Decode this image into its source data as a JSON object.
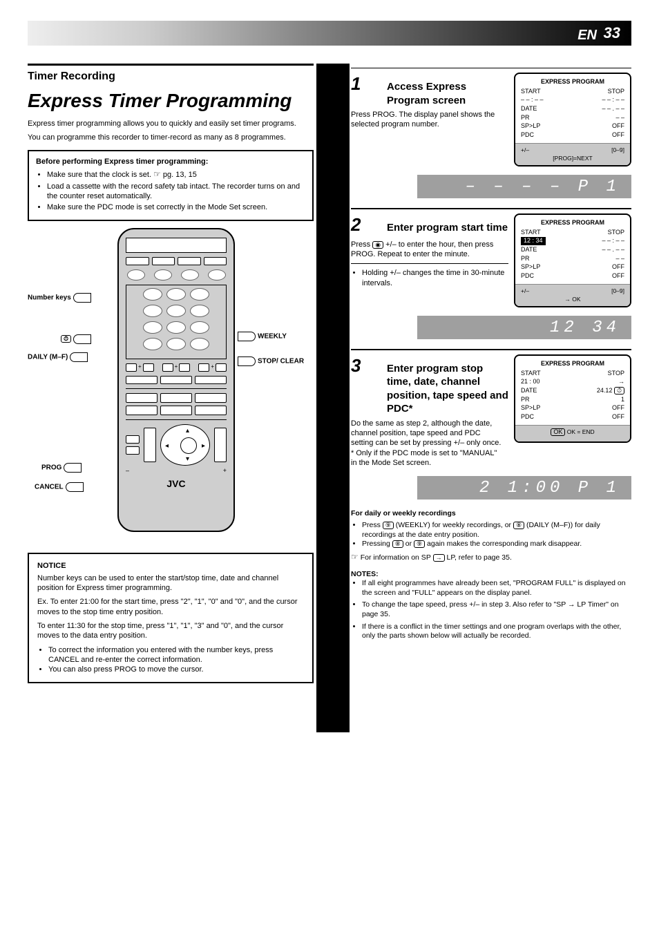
{
  "page": {
    "number": "33",
    "section": "EN"
  },
  "left": {
    "big_title": "Express Timer Programming",
    "sub_title": "Timer Recording",
    "intro1": "Express timer programming allows you to quickly and easily set timer programs.",
    "intro2": "You can programme this recorder to timer-record as many as 8 programmes.",
    "before": {
      "heading": "Before performing Express timer programming:",
      "i1_a": "Make sure that the clock is set.",
      "i1_b": "pg. 13, 15",
      "i2": "Load a cassette with the record safety tab intact. The recorder turns on and the counter reset automatically.",
      "i3": "Make sure the PDC mode is set correctly in the Mode Set screen."
    },
    "callouts": {
      "number": "Number keys",
      "timer_key": "⏱",
      "daily": "DAILY (M–F)",
      "weekly": "WEEKLY",
      "prog": "PROG",
      "cancel": "CANCEL",
      "stop": "STOP/ CLEAR"
    },
    "remote_logo": "JVC",
    "notice": {
      "title": "NOTICE",
      "p1": "Number keys can be used to enter the start/stop time, date and channel position for Express timer programming.",
      "p2_a": "Ex. To enter 21:00 for the start time, press \"2\", \"1\", \"0\" and \"0\", and the cursor moves to the stop time entry position.",
      "p2_b": "To enter 11:30 for the stop time, press \"1\", \"1\", \"3\" and \"0\", and the cursor moves to the data entry position.",
      "li1": "To correct the information you entered with the number keys, press CANCEL and re-enter the correct information.",
      "li2": "You can also press PROG to move the cursor."
    }
  },
  "right": {
    "s1": {
      "num": "1",
      "title": "Access Express Program screen",
      "body": "Press PROG. The display panel shows the selected program number.",
      "osd": {
        "title": "EXPRESS PROGRAM",
        "r1l": "START",
        "r1r": "STOP",
        "r2l": "– – : – –",
        "r2r": "– – : – –",
        "r3l": "DATE",
        "r3r": "– – . – –",
        "r4l": "PR",
        "r4r": "– –",
        "r5l": "SP>LP",
        "r5r": "OFF",
        "r6l": "PDC",
        "r6r": "OFF",
        "botl": "+/–",
        "botm": "[PROG]=NEXT",
        "botr": "[0–9]"
      },
      "vfd": "– – – – P 1"
    },
    "s2": {
      "num": "2",
      "title": "Enter program start time",
      "body_a": "Press",
      "body_b": "+/– to enter the hour, then press PROG. Repeat to enter the minute.",
      "bullet": "Holding +/– changes the time in 30-minute intervals.",
      "osd": {
        "title": "EXPRESS PROGRAM",
        "r1l": "START",
        "r1r": "STOP",
        "sel": "12 : 34",
        "r2r": "– – : – –",
        "r3l": "DATE",
        "r3r": "– – . – –",
        "r4l": "PR",
        "r4r": "– –",
        "r5l": "SP>LP",
        "r5r": "OFF",
        "r6l": "PDC",
        "r6r": "OFF",
        "botl": "+/–",
        "botm": "→ OK",
        "botr": "[0–9]"
      },
      "vfd": "12 34"
    },
    "s3": {
      "num": "3",
      "title": "Enter program stop time, date, channel position, tape speed and PDC*",
      "body": "Do the same as step 2, although the date, channel position, tape speed and PDC setting can be set by pressing +/– only once. * Only if the PDC mode is set to \"MANUAL\" in the Mode Set screen.",
      "osd": {
        "title": "EXPRESS PROGRAM",
        "r1l": "START",
        "r1r": "STOP",
        "r2l": "21 : 00",
        "r2r": "→",
        "r3l": "DATE",
        "r3r": "24.12",
        "r3d": "⏱",
        "r4l": "PR",
        "r4r": "1",
        "r5l": "SP>LP",
        "r5r": "OFF",
        "r6l": "PDC",
        "r6r": "OFF",
        "bot": "OK = END"
      },
      "vfd": "2 1:00 P 1"
    },
    "dw": {
      "heading": "For daily or weekly recordings",
      "b1a": "Press",
      "b1b": "(WEEKLY) for weekly recordings, or",
      "b1c": "(DAILY (M–F)) for daily recordings at the date entry position.",
      "b2a": "Pressing",
      "b2b": "or",
      "b2c": "again makes the corresponding mark disappear.",
      "b3a": "For information on SP",
      "b3b": "LP, refer to page 35."
    },
    "notes": {
      "heading": "NOTES:",
      "n1": "If all eight programmes have already been set, \"PROGRAM FULL\" is displayed on the screen and \"FULL\" appears on the display panel.",
      "n2": "To change the tape speed, press +/– in step 3. Also refer to \"SP → LP Timer\" on page 35.",
      "n3": "If there is a conflict in the timer settings and one program overlaps with the other, only the parts shown below will actually be recorded."
    }
  }
}
